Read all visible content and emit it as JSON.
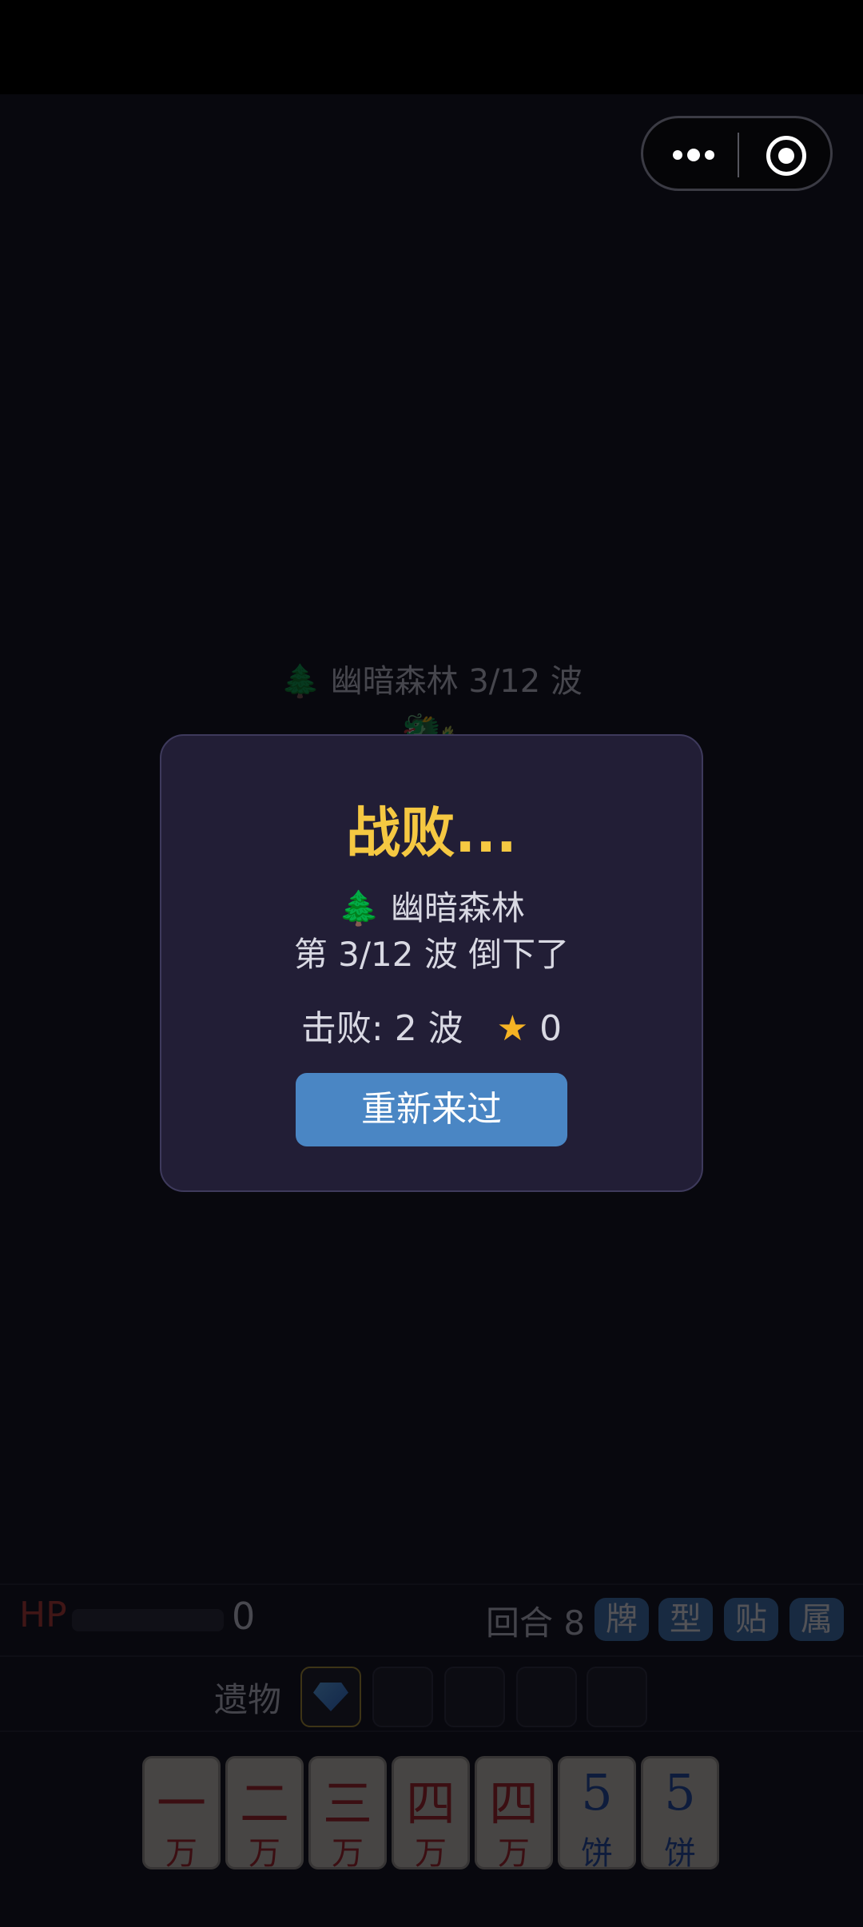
{
  "stage": {
    "icon": "tree-icon",
    "title": "🌲 幽暗森林  3/12 波"
  },
  "hud": {
    "hp_label": "HP",
    "hp_value": "0",
    "round_label": "回合 8",
    "buttons": [
      "牌",
      "型",
      "贴",
      "属"
    ]
  },
  "relics": {
    "label": "遗物",
    "slots": [
      "gem-icon",
      "",
      "",
      "",
      ""
    ]
  },
  "hand": [
    {
      "num": "一",
      "suit": "万"
    },
    {
      "num": "二",
      "suit": "万"
    },
    {
      "num": "三",
      "suit": "万"
    },
    {
      "num": "四",
      "suit": "万"
    },
    {
      "num": "四",
      "suit": "万"
    },
    {
      "num": "5",
      "suit": "饼"
    },
    {
      "num": "5",
      "suit": "饼"
    }
  ],
  "dialog": {
    "title": "战败...",
    "stage_name": "幽暗森林",
    "wave_text": "第 3/12 波 倒下了",
    "defeated_text": "击败: 2 波",
    "stars": "0",
    "retry_label": "重新来过"
  },
  "colors": {
    "gold": "#f5c842",
    "button_blue": "#4a86c4",
    "dialog_bg": "#221e36"
  }
}
